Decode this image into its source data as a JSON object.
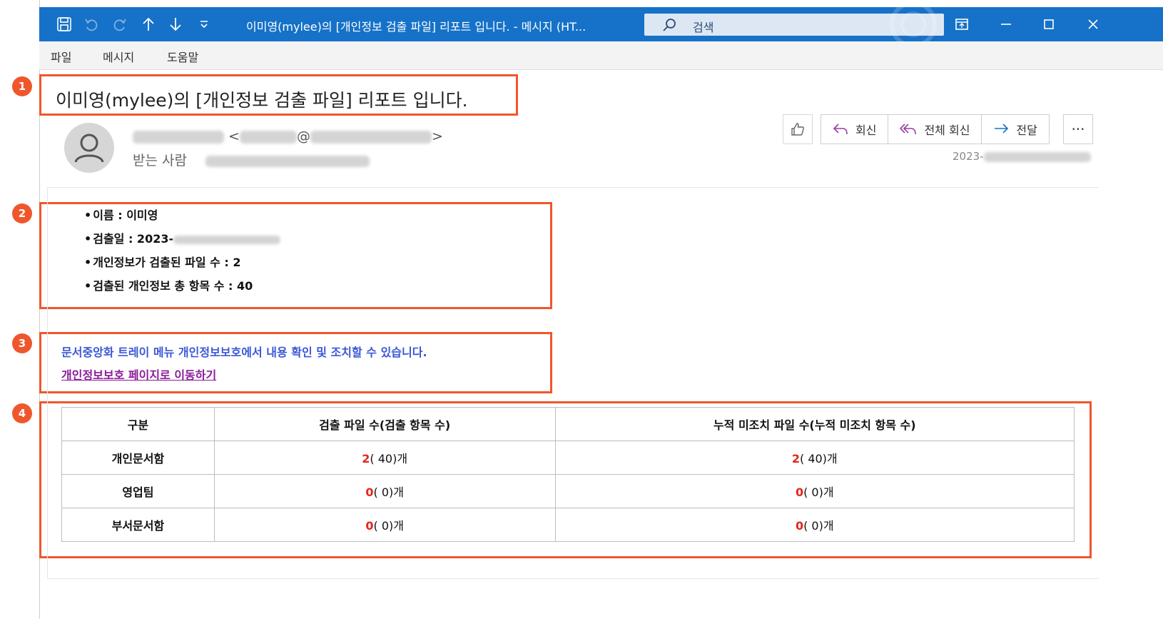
{
  "window": {
    "title": "이미영(mylee)의 [개인정보 검출 파일] 리포트 입니다.  -  메시지 (HT...",
    "search_placeholder": "검색"
  },
  "menu": {
    "items": [
      "파일",
      "메시지",
      "도움말"
    ]
  },
  "markers": [
    "1",
    "2",
    "3",
    "4"
  ],
  "email": {
    "subject": "이미영(mylee)의 [개인정보 검출 파일] 리포트 입니다.",
    "sender_open": "<",
    "sender_at": "@",
    "sender_close": ">",
    "recipient_label": "받는 사람",
    "timestamp": "2023-"
  },
  "actions": {
    "reply": "회신",
    "reply_all": "전체 회신",
    "forward": "전달",
    "more": "···"
  },
  "report": {
    "items": [
      "이름 : 이미영",
      "검출일 : 2023-",
      "개인정보가 검출된 파일 수 : 2",
      "검출된 개인정보 총 항목 수 : 40"
    ],
    "notice": "문서중앙화 트레이 메뉴 개인정보보호에서 내용 확인 및 조치할 수 있습니다.",
    "link": "개인정보보호 페이지로 이동하기"
  },
  "table": {
    "headers": [
      "구분",
      "검출 파일 수(검출 항목 수)",
      "누적 미조치 파일 수(누적 미조치 항목 수)"
    ],
    "rows": [
      {
        "label": "개인문서함",
        "detected_count": "2",
        "detected_rest": "( 40)개",
        "pending_count": "2",
        "pending_rest": "( 40)개"
      },
      {
        "label": "영업팀",
        "detected_count": "0",
        "detected_rest": "( 0)개",
        "pending_count": "0",
        "pending_rest": "( 0)개"
      },
      {
        "label": "부서문서함",
        "detected_count": "0",
        "detected_rest": "( 0)개",
        "pending_count": "0",
        "pending_rest": "( 0)개"
      }
    ]
  },
  "colors": {
    "titlebar": "#1672c8",
    "marker": "#f0562c",
    "notice": "#3a57d6",
    "link": "#8a1a9a",
    "count_red": "#e0271c"
  },
  "icons": [
    "save-icon",
    "undo-icon",
    "redo-icon",
    "arrow-up-icon",
    "arrow-down-icon",
    "customize-icon",
    "search-icon",
    "popout-icon",
    "minimize-icon",
    "maximize-icon",
    "close-icon",
    "avatar-icon",
    "thumbs-up-icon",
    "reply-icon",
    "reply-all-icon",
    "forward-icon"
  ]
}
